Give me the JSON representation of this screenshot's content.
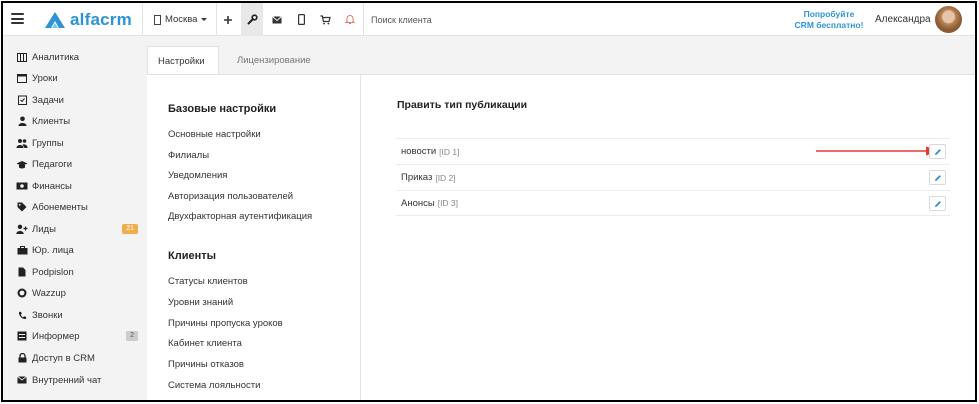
{
  "app": {
    "logo_text": "alfacrm",
    "brand_color": "#2d93d6",
    "city": "Москва",
    "search_placeholder": "Поиск клиента",
    "promo": [
      "Попробуйте",
      "CRM бесплатно!"
    ],
    "user_name": "Александра"
  },
  "topbar_icons": [
    "plus-icon",
    "wrench-icon",
    "envelope-icon",
    "mobile-icon",
    "cart-icon",
    "bell-icon"
  ],
  "sidebar": {
    "items": [
      {
        "label": "Аналитика",
        "icon": "analytics-icon"
      },
      {
        "label": "Уроки",
        "icon": "calendar-icon"
      },
      {
        "label": "Задачи",
        "icon": "tasks-icon"
      },
      {
        "label": "Клиенты",
        "icon": "user-icon"
      },
      {
        "label": "Группы",
        "icon": "users-icon"
      },
      {
        "label": "Педагоги",
        "icon": "graduation-cap-icon"
      },
      {
        "label": "Финансы",
        "icon": "money-icon"
      },
      {
        "label": "Абонементы",
        "icon": "tag-icon"
      },
      {
        "label": "Лиды",
        "icon": "user-plus-icon",
        "badge": "21",
        "badge_color": "#f0ad4e"
      },
      {
        "label": "Юр. лица",
        "icon": "briefcase-icon"
      },
      {
        "label": "Podpislon",
        "icon": "file-icon"
      },
      {
        "label": "Wazzup",
        "icon": "whatsapp-icon"
      },
      {
        "label": "Звонки",
        "icon": "phone-icon"
      },
      {
        "label": "Информер",
        "icon": "informer-icon",
        "badge": "2",
        "badge_color": "#cccccc"
      },
      {
        "label": "Доступ в CRM",
        "icon": "lock-icon"
      },
      {
        "label": "Внутренний чат",
        "icon": "chat-icon"
      }
    ]
  },
  "tabs": [
    {
      "label": "Настройки",
      "active": true
    },
    {
      "label": "Лицензирование",
      "active": false
    }
  ],
  "settings_menu": {
    "basic": {
      "title": "Базовые настройки",
      "links": [
        "Основные настройки",
        "Филиалы",
        "Уведомления",
        "Авторизация пользователей",
        "Двухфакторная аутентификация"
      ]
    },
    "clients": {
      "title": "Клиенты",
      "links": [
        "Статусы клиентов",
        "Уровни знаний",
        "Причины пропуска уроков",
        "Кабинет клиента",
        "Причины отказов",
        "Система лояльности"
      ]
    }
  },
  "main": {
    "title": "Править тип публикации",
    "rows": [
      {
        "name": "новости",
        "id": "[ID 1]"
      },
      {
        "name": "Приказ",
        "id": "[ID 2]"
      },
      {
        "name": "Анонсы",
        "id": "[ID 3]"
      }
    ],
    "annotation_color": "#e53935"
  }
}
